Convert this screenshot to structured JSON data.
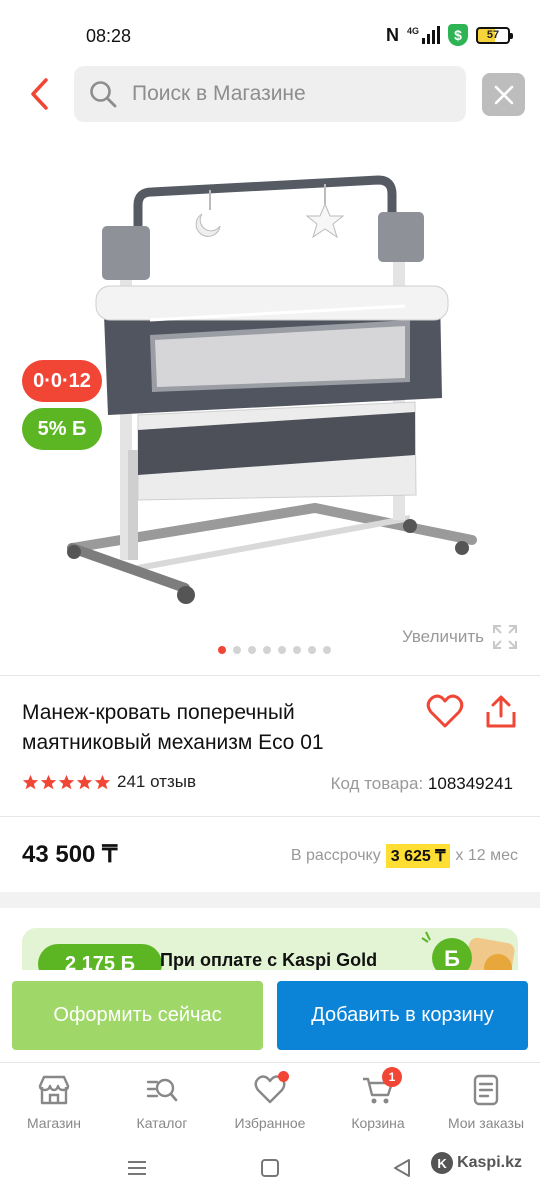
{
  "status_bar": {
    "time": "08:28",
    "network": "4G",
    "battery": "57"
  },
  "search": {
    "placeholder": "Поиск в Магазине"
  },
  "product": {
    "badges": {
      "installment": "0·0·12",
      "bonus": "5% Б"
    },
    "zoom_label": "Увеличить",
    "gallery_dots": 8,
    "gallery_active_index": 0,
    "title": "Манеж-кровать поперечный маятниковый механизм Eco 01",
    "rating": 5,
    "reviews": "241 отзыв",
    "code_label": "Код товара:",
    "code_value": "108349241",
    "price": "43 500 ₸",
    "installment_prefix": "В рассрочку",
    "installment_amount": "3 625 ₸",
    "installment_suffix": "x 12 мес"
  },
  "promo": {
    "bonus": "2 175 Б",
    "text": "При оплате с Kaspi Gold"
  },
  "actions": {
    "buy_now": "Оформить сейчас",
    "add_to_cart": "Добавить в корзину"
  },
  "nav": {
    "items": [
      {
        "label": "Магазин",
        "icon": "shop-icon"
      },
      {
        "label": "Каталог",
        "icon": "catalog-search-icon"
      },
      {
        "label": "Избранное",
        "icon": "heart-icon"
      },
      {
        "label": "Корзина",
        "icon": "cart-icon"
      },
      {
        "label": "Мои заказы",
        "icon": "orders-icon"
      }
    ],
    "cart_count": "1"
  },
  "watermark": "Kaspi.kz",
  "colors": {
    "accent_red": "#f14635",
    "kaspi_green": "#5cb624",
    "kaspi_blue": "#0b84d8",
    "installment_yellow": "#fede33"
  }
}
